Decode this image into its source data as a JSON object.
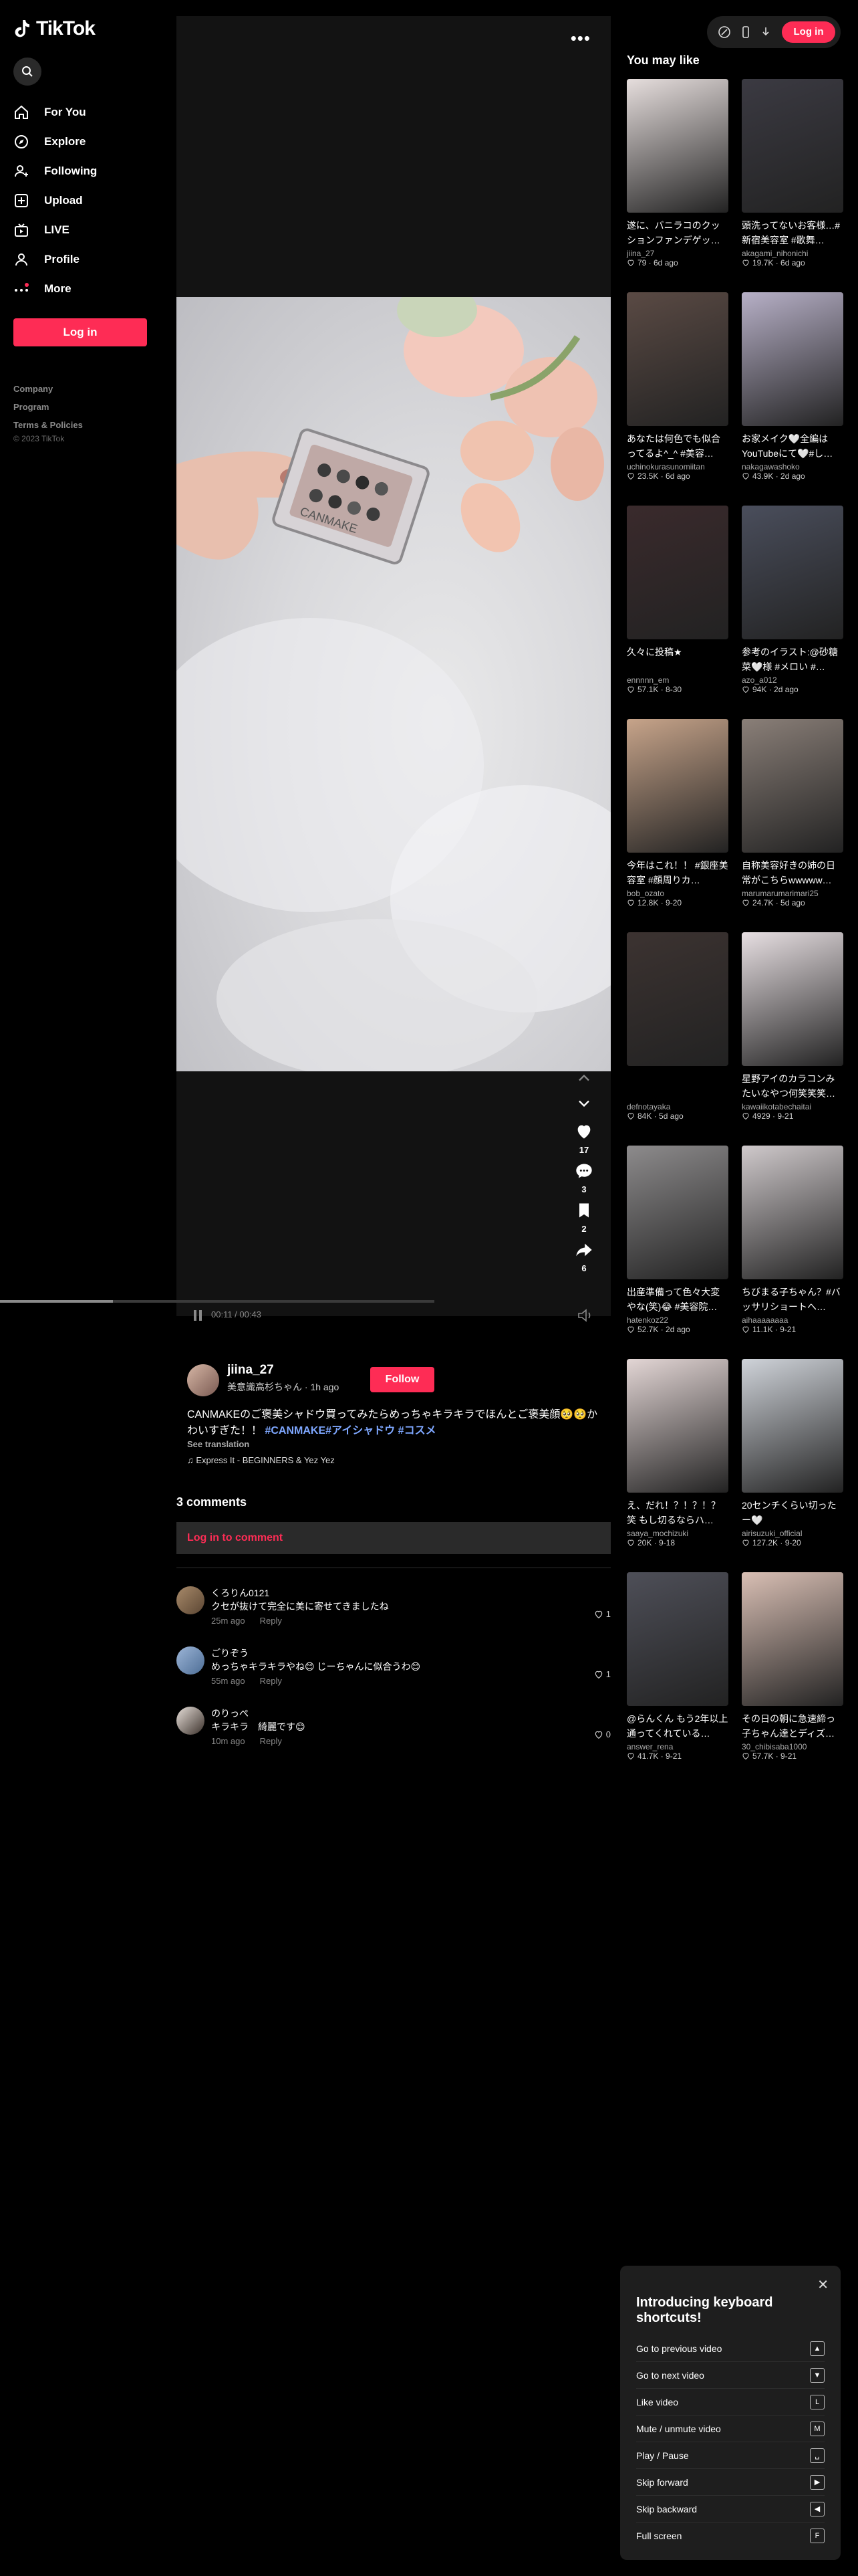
{
  "app": {
    "name": "TikTok"
  },
  "sidebar": {
    "items": [
      {
        "label": "For You"
      },
      {
        "label": "Explore"
      },
      {
        "label": "Following"
      },
      {
        "label": "Upload"
      },
      {
        "label": "LIVE"
      },
      {
        "label": "Profile"
      },
      {
        "label": "More"
      }
    ],
    "login_label": "Log in",
    "footer": [
      "Company",
      "Program",
      "Terms & Policies"
    ],
    "copyright": "© 2023 TikTok"
  },
  "topbar": {
    "login_label": "Log in"
  },
  "video": {
    "more_label": "•••",
    "time": "00:11 / 00:43",
    "progress_fraction": 0.26,
    "likes": "17",
    "comments": "3",
    "saves": "2",
    "shares": "6"
  },
  "author": {
    "username": "jiina_27",
    "subtitle": "美意識高杉ちゃん · 1h ago",
    "follow_label": "Follow",
    "caption_text": "CANMAKEのご褒美シャドウ買ってみたらめっちゃキラキラでほんとご褒美顔🥺🥺かわいすぎた！！",
    "caption_tags": "#CANMAKE#アイシャドウ #コスメ",
    "see_translation": "See translation",
    "music": "♫ Express It - BEGINNERS & Yez Yez"
  },
  "comments": {
    "title": "3 comments",
    "login_prompt": "Log in to comment",
    "reply_label": "Reply",
    "items": [
      {
        "name": "くろりん0121",
        "text": "クセが抜けて完全に美に寄せてきましたね",
        "time": "25m ago",
        "likes": "1"
      },
      {
        "name": "ごりぞう",
        "text": "めっちゃキラキラやね😊 じーちゃんに似合うわ😊",
        "time": "55m ago",
        "likes": "1"
      },
      {
        "name": "のりっぺ",
        "text": "キラキラ　綺麗です😊",
        "time": "10m ago",
        "likes": "0"
      }
    ]
  },
  "you_may_like": {
    "title": "You may like",
    "cards": [
      {
        "title": "遂に、バニラコのクッションファンデゲッ…",
        "user": "jiina_27",
        "meta": "79 · 6d ago",
        "color": "#e6dedd"
      },
      {
        "title": "頭洗ってないお客様…#新宿美容室 #歌舞…",
        "user": "akagami_nihonichi",
        "meta": "19.7K · 6d ago",
        "color": "#3b3a42"
      },
      {
        "title": "あなたは何色でも似合ってるよ^_^ #美容…",
        "user": "uchinokurasunomiitan",
        "meta": "23.5K · 6d ago",
        "color": "#5a4a44"
      },
      {
        "title": "お家メイク🤍全編はYouTubeにて🤍#し…",
        "user": "nakagawashoko",
        "meta": "43.9K · 2d ago",
        "color": "#b7b0c7"
      },
      {
        "title": "久々に投稿★",
        "user": "ennnnn_em",
        "meta": "57.1K · 8-30",
        "color": "#3a2a2c"
      },
      {
        "title": "参考のイラスト:@砂糖菜🤍様 #メロい #…",
        "user": "azo_a012",
        "meta": "94K · 2d ago",
        "color": "#4a4e5c"
      },
      {
        "title": "今年はこれ！！ #銀座美容室 #顔周りカ…",
        "user": "bob_ozato",
        "meta": "12.8K · 9-20",
        "color": "#c7a48a"
      },
      {
        "title": "自称美容好きの姉の日常がこちらwwwww…",
        "user": "marumarumarimari25",
        "meta": "24.7K · 5d ago",
        "color": "#8a7f78"
      },
      {
        "title": "",
        "user": "defnotayaka",
        "meta": "84K · 5d ago",
        "color": "#3c3331"
      },
      {
        "title": "星野アイのカラコンみたいなやつ何笑笑笑…",
        "user": "kawaiikotabechaitai",
        "meta": "4929 · 9-21",
        "color": "#e7dfe2"
      },
      {
        "title": "出産準備って色々大変やな(笑)😂 #美容院…",
        "user": "hatenkoz22",
        "meta": "52.7K · 2d ago",
        "color": "#8d8b8c"
      },
      {
        "title": "ちびまる子ちゃん？#バッサリショートへ…",
        "user": "aihaaaaaaaa",
        "meta": "11.1K · 9-21",
        "color": "#cfc9cb"
      },
      {
        "title": "え、だれ！？！？！？笑 もし切るならハ…",
        "user": "saaya_mochizuki",
        "meta": "20K · 9-18",
        "color": "#e3d6d5"
      },
      {
        "title": "20センチくらい切ったー🤍",
        "user": "airisuzuki_official",
        "meta": "127.2K · 9-20",
        "color": "#cfd3d9"
      },
      {
        "title": "@らんくん もう2年以上通ってくれている…",
        "user": "answer_rena",
        "meta": "41.7K · 9-21",
        "color": "#4e4f58"
      },
      {
        "title": "その日の朝に急速締っ子ちゃん達とディズ…",
        "user": "30_chibisaba1000",
        "meta": "57.7K · 9-21",
        "color": "#d9bfb4"
      }
    ]
  },
  "shortcuts": {
    "close_label": "✕",
    "title": "Introducing keyboard shortcuts!",
    "items": [
      {
        "label": "Go to previous video",
        "key": "▲"
      },
      {
        "label": "Go to next video",
        "key": "▼"
      },
      {
        "label": "Like video",
        "key": "L"
      },
      {
        "label": "Mute / unmute video",
        "key": "M"
      },
      {
        "label": "Play / Pause",
        "key": "␣"
      },
      {
        "label": "Skip forward",
        "key": "▶"
      },
      {
        "label": "Skip backward",
        "key": "◀"
      },
      {
        "label": "Full screen",
        "key": "F"
      }
    ]
  },
  "colors": {
    "accent": "#fe2c55",
    "tag": "#7ea7ff"
  }
}
